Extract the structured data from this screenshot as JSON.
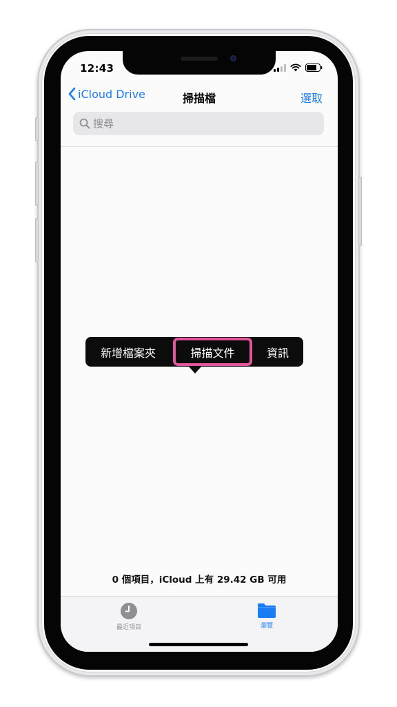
{
  "status": {
    "time": "12:43"
  },
  "nav": {
    "back_label": "iCloud Drive",
    "title": "掃描檔",
    "select_label": "選取"
  },
  "search": {
    "placeholder": "搜尋"
  },
  "context_menu": {
    "items": [
      {
        "label": "新增檔案夾"
      },
      {
        "label": "掃描文件",
        "highlighted": true
      },
      {
        "label": "資訊"
      }
    ]
  },
  "storage_info": "0 個項目，iCloud 上有 29.42 GB 可用",
  "tabs": [
    {
      "label": "最近項目",
      "icon": "clock-icon",
      "active": false
    },
    {
      "label": "瀏覽",
      "icon": "folder-icon",
      "active": true
    }
  ],
  "colors": {
    "accent": "#1a7cf5",
    "highlight": "#e2559b",
    "menu_bg": "#0c0c0c"
  }
}
